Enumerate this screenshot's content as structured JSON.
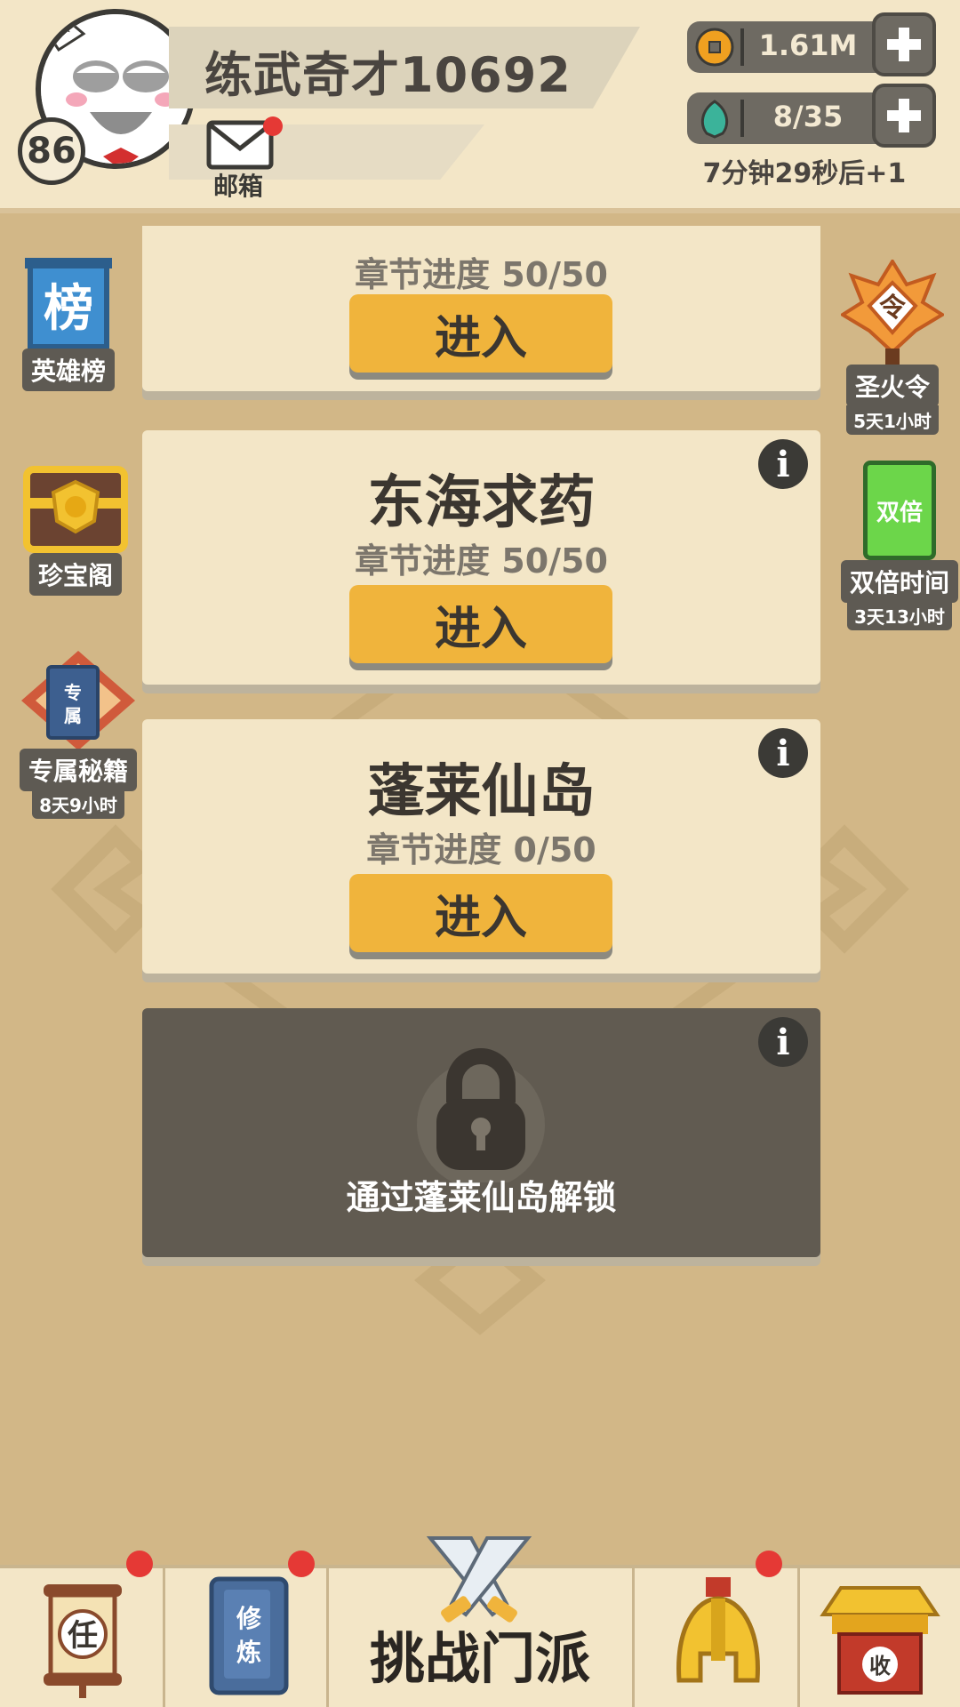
{
  "player": {
    "name": "练武奇才10692",
    "level": "86",
    "mail_label": "邮箱"
  },
  "resources": {
    "coins": "1.61M",
    "energy": "8/35",
    "energy_timer": "7分钟29秒后+1"
  },
  "left_sidebar": [
    {
      "label": "英雄榜",
      "icon": "ranking-banner-icon"
    },
    {
      "label": "珍宝阁",
      "icon": "treasure-chest-icon"
    },
    {
      "label": "专属秘籍",
      "icon": "exclusive-book-icon",
      "sub": "8天9小时"
    }
  ],
  "right_sidebar": [
    {
      "label": "圣火令",
      "icon": "holy-flame-token-icon",
      "sub": "5天1小时"
    },
    {
      "label": "双倍时间",
      "icon": "double-card-icon",
      "icon_text": "双倍",
      "sub": "3天13小时"
    }
  ],
  "stages": [
    {
      "title": "",
      "progress": "章节进度 50/50",
      "button": "进入"
    },
    {
      "title": "东海求药",
      "progress": "章节进度 50/50",
      "button": "进入"
    },
    {
      "title": "蓬莱仙岛",
      "progress": "章节进度 0/50",
      "button": "进入"
    }
  ],
  "locked_stage": {
    "text": "通过蓬莱仙岛解锁"
  },
  "bottom_nav": {
    "challenge_label": "挑战门派",
    "task_icon_text": "任",
    "cultivate_icon_text": "修炼",
    "shop_icon_text": "收"
  },
  "colors": {
    "background": "#d2b787",
    "panel": "#f3e6c7",
    "button": "#f0b43c",
    "locked": "#615b51",
    "alert": "#e53935"
  }
}
